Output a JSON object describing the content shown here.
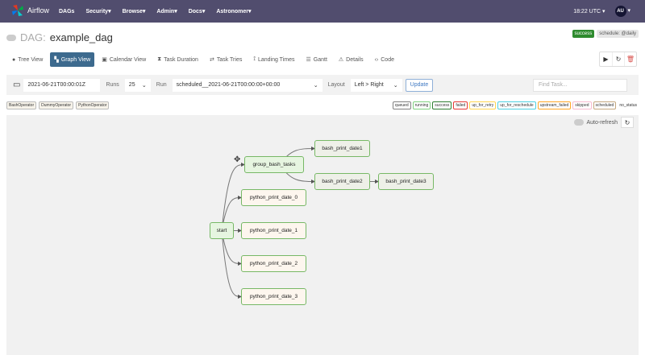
{
  "nav": {
    "brand": "Airflow",
    "menu": [
      "DAGs",
      "Security",
      "Browse",
      "Admin",
      "Docs",
      "Astronomer"
    ],
    "time": "18:22 UTC",
    "user": "AU"
  },
  "dag": {
    "prefix": "DAG:",
    "name": "example_dag",
    "status": "success",
    "schedule": "schedule: @daily"
  },
  "tabs": [
    {
      "label": "Tree View",
      "icon": "tree-icon"
    },
    {
      "label": "Graph View",
      "icon": "graph-icon",
      "active": true
    },
    {
      "label": "Calendar View",
      "icon": "calendar-icon"
    },
    {
      "label": "Task Duration",
      "icon": "hourglass-icon"
    },
    {
      "label": "Task Tries",
      "icon": "retry-icon"
    },
    {
      "label": "Landing Times",
      "icon": "landing-icon"
    },
    {
      "label": "Gantt",
      "icon": "gantt-icon"
    },
    {
      "label": "Details",
      "icon": "warning-icon"
    },
    {
      "label": "Code",
      "icon": "code-icon"
    }
  ],
  "form": {
    "date": "2021-06-21T00:00:01Z",
    "runs_label": "Runs",
    "runs": "25",
    "run_label": "Run",
    "run": "scheduled__2021-06-21T00:00:00+00:00",
    "layout_label": "Layout",
    "layout": "Left > Right",
    "update": "Update",
    "find_placeholder": "Find Task..."
  },
  "operators": [
    "BashOperator",
    "DummyOperator",
    "PythonOperator"
  ],
  "states": [
    {
      "label": "queued",
      "color": "#808080"
    },
    {
      "label": "running",
      "color": "#7fd07f"
    },
    {
      "label": "success",
      "color": "#2e7d32"
    },
    {
      "label": "failed",
      "color": "#e53935"
    },
    {
      "label": "up_for_retry",
      "color": "#ffd54f"
    },
    {
      "label": "up_for_reschedule",
      "color": "#4dd0e1"
    },
    {
      "label": "upstream_failed",
      "color": "#ffa726"
    },
    {
      "label": "skipped",
      "color": "#f8bbd0"
    },
    {
      "label": "scheduled",
      "color": "#c5a880"
    },
    {
      "label": "no_status",
      "color": "none"
    }
  ],
  "graph": {
    "auto_refresh": "Auto-refresh",
    "nodes": [
      {
        "id": "start",
        "label": "start"
      },
      {
        "id": "group",
        "label": "group_bash_tasks"
      },
      {
        "id": "b1",
        "label": "bash_print_date1"
      },
      {
        "id": "b2",
        "label": "bash_print_date2"
      },
      {
        "id": "b3",
        "label": "bash_print_date3"
      },
      {
        "id": "p0",
        "label": "python_print_date_0"
      },
      {
        "id": "p1",
        "label": "python_print_date_1"
      },
      {
        "id": "p2",
        "label": "python_print_date_2"
      },
      {
        "id": "p3",
        "label": "python_print_date_3"
      }
    ],
    "edges": [
      [
        "start",
        "group"
      ],
      [
        "start",
        "p0"
      ],
      [
        "start",
        "p1"
      ],
      [
        "start",
        "p2"
      ],
      [
        "start",
        "p3"
      ],
      [
        "group",
        "b1"
      ],
      [
        "group",
        "b2"
      ],
      [
        "b2",
        "b3"
      ]
    ]
  },
  "colors": {
    "nav": "#514d6e",
    "active_tab": "#3d6a8e",
    "success": "#2e8b2e",
    "node_border": "#77b866"
  }
}
